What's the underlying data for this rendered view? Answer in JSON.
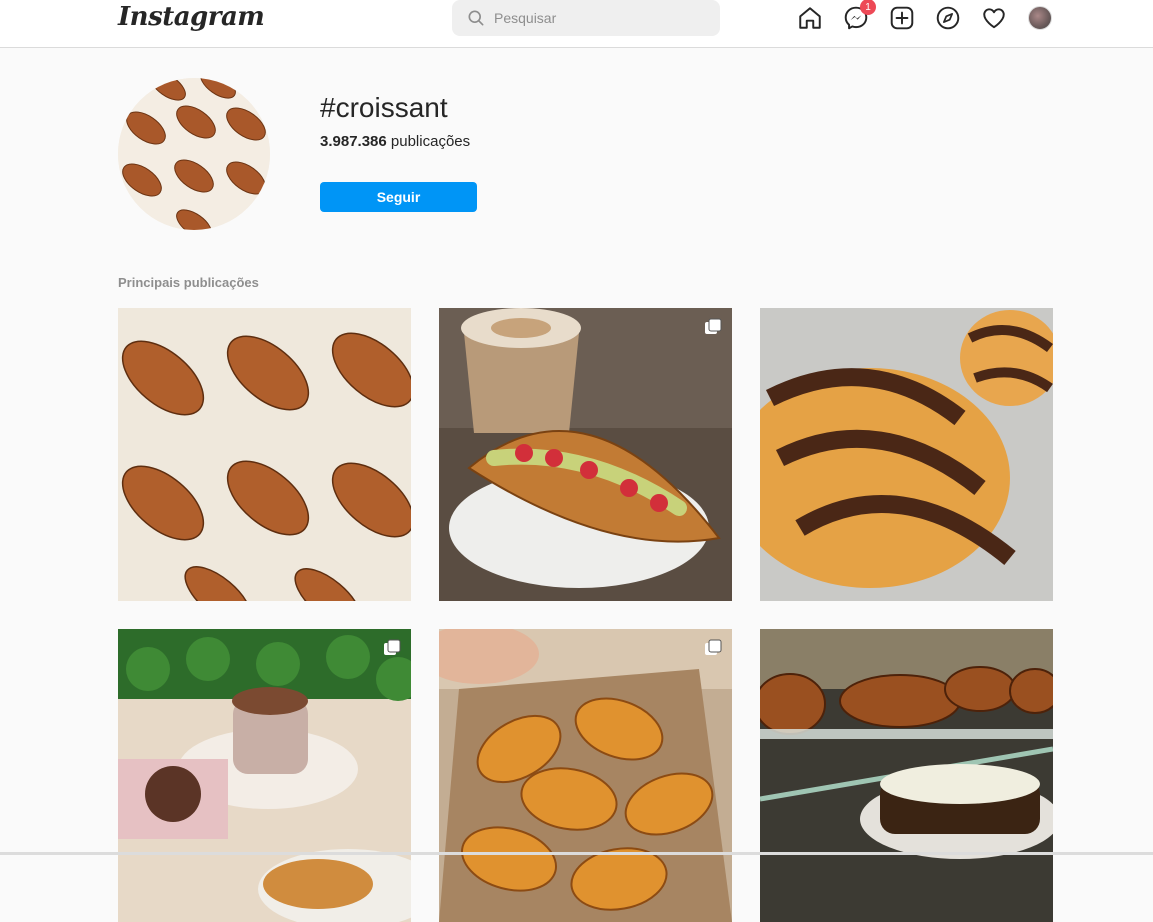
{
  "topbar": {
    "logo": "Instagram",
    "search_placeholder": "Pesquisar",
    "messenger_badge": "1"
  },
  "hashtag": {
    "title": "#croissant",
    "count": "3.987.386",
    "count_label": "publicações",
    "follow_label": "Seguir"
  },
  "section": {
    "top_posts_title": "Principais publicações"
  },
  "icons": [
    "search-icon",
    "home-icon",
    "messenger-icon",
    "new-post-icon",
    "explore-icon",
    "heart-icon",
    "multiple-posts-icon"
  ],
  "colors": {
    "accent": "#0095f6",
    "badge": "#ed4956",
    "background": "#fafafa"
  }
}
